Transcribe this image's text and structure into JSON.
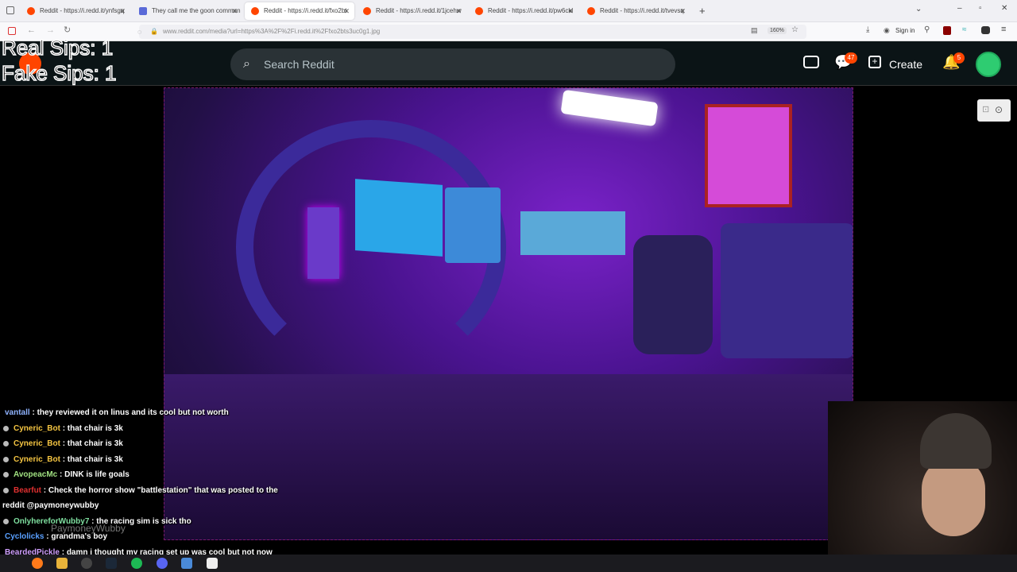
{
  "browser": {
    "tabs": [
      {
        "title": "Reddit - https://i.redd.it/ynfsgq",
        "icon": "reddit"
      },
      {
        "title": "They call me the goon comman",
        "icon": "doc"
      },
      {
        "title": "Reddit - https://i.redd.it/fxo2bt",
        "icon": "reddit"
      },
      {
        "title": "Reddit - https://i.redd.it/1jcehw",
        "icon": "reddit"
      },
      {
        "title": "Reddit - https://i.redd.it/pw6ckl",
        "icon": "reddit"
      },
      {
        "title": "Reddit - https://i.redd.it/tvevsq",
        "icon": "reddit"
      }
    ],
    "url": "www.reddit.com/media?url=https%3A%2F%2Fi.redd.it%2Ffxo2bts3uc0g1.jpg",
    "zoom": "160%",
    "signin": "Sign in"
  },
  "reddit": {
    "search_placeholder": "Search Reddit",
    "chat_badge": "47",
    "create_label": "Create",
    "notif_badge": "5"
  },
  "overlay": {
    "real": "Real Sips: 1",
    "fake": "Fake Sips: 1"
  },
  "chat": [
    {
      "user": "vantall",
      "color": "#8fb3ff",
      "msg": ": they reviewed it on linus and its cool but not worth"
    },
    {
      "user": "Cyneric_Bot",
      "color": "#f5c542",
      "msg": ": that chair is 3k"
    },
    {
      "user": "Cyneric_Bot",
      "color": "#f5c542",
      "msg": ": that chair is 3k"
    },
    {
      "user": "Cyneric_Bot",
      "color": "#f5c542",
      "msg": ": that chair is 3k"
    },
    {
      "user": "AvopeacMc",
      "color": "#a0e080",
      "msg": ": DINK is life goals"
    },
    {
      "user": "Bearfut",
      "color": "#e03030",
      "msg": ": Check the horror show \"battlestation\" that was posted to the"
    },
    {
      "user": "",
      "color": "#ffffff",
      "msg": "reddit @paymoneywubby"
    },
    {
      "user": "OnlyhereforWubby7",
      "color": "#7fe0a0",
      "msg": ": the racing sim is sick tho"
    },
    {
      "user": "Cyclolicks",
      "color": "#5aa0ff",
      "msg": ": grandma's boy"
    },
    {
      "user": "BeardedPickle",
      "color": "#d0a0ff",
      "msg": ": damn i thought my racing set up was cool but not now"
    }
  ],
  "watermark": "PaymoneyWubby"
}
